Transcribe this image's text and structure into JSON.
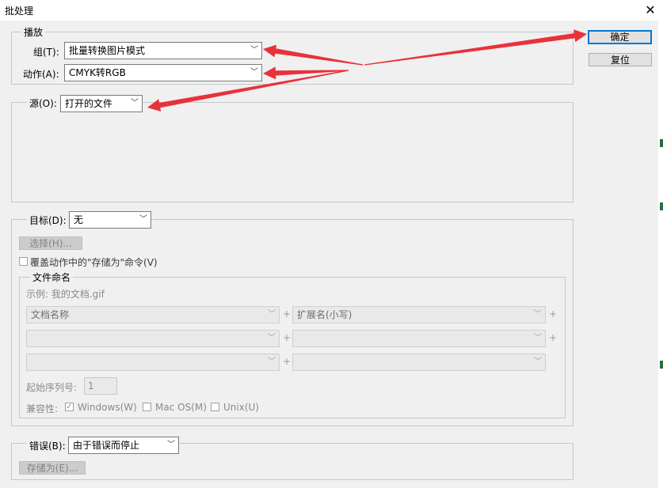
{
  "window": {
    "title": "批处理",
    "close_glyph": "✕"
  },
  "buttons": {
    "ok": "确定",
    "reset": "复位"
  },
  "play": {
    "legend": "播放",
    "set_label": "组(T):",
    "set_value": "批量转换图片模式",
    "action_label": "动作(A):",
    "action_value": "CMYK转RGB"
  },
  "source": {
    "label": "源(O):",
    "value": "打开的文件"
  },
  "destination": {
    "label": "目标(D):",
    "value": "无",
    "choose_button": "选择(H)...",
    "override_label": "覆盖动作中的\"存储为\"命令(V)",
    "naming": {
      "legend": "文件命名",
      "example": "示例: 我的文档.gif",
      "fields": [
        "文档名称",
        "扩展名(小写)",
        "",
        "",
        "",
        ""
      ],
      "start_serial_label": "起始序列号:",
      "start_serial_value": "1",
      "compat_label": "兼容性:",
      "compat_windows": "Windows(W)",
      "compat_mac": "Mac OS(M)",
      "compat_unix": "Unix(U)"
    }
  },
  "errors": {
    "label": "错误(B):",
    "value": "由于错误而停止",
    "save_as_button": "存储为(E)..."
  },
  "annotation": {
    "arrow_color": "#e8323a"
  }
}
